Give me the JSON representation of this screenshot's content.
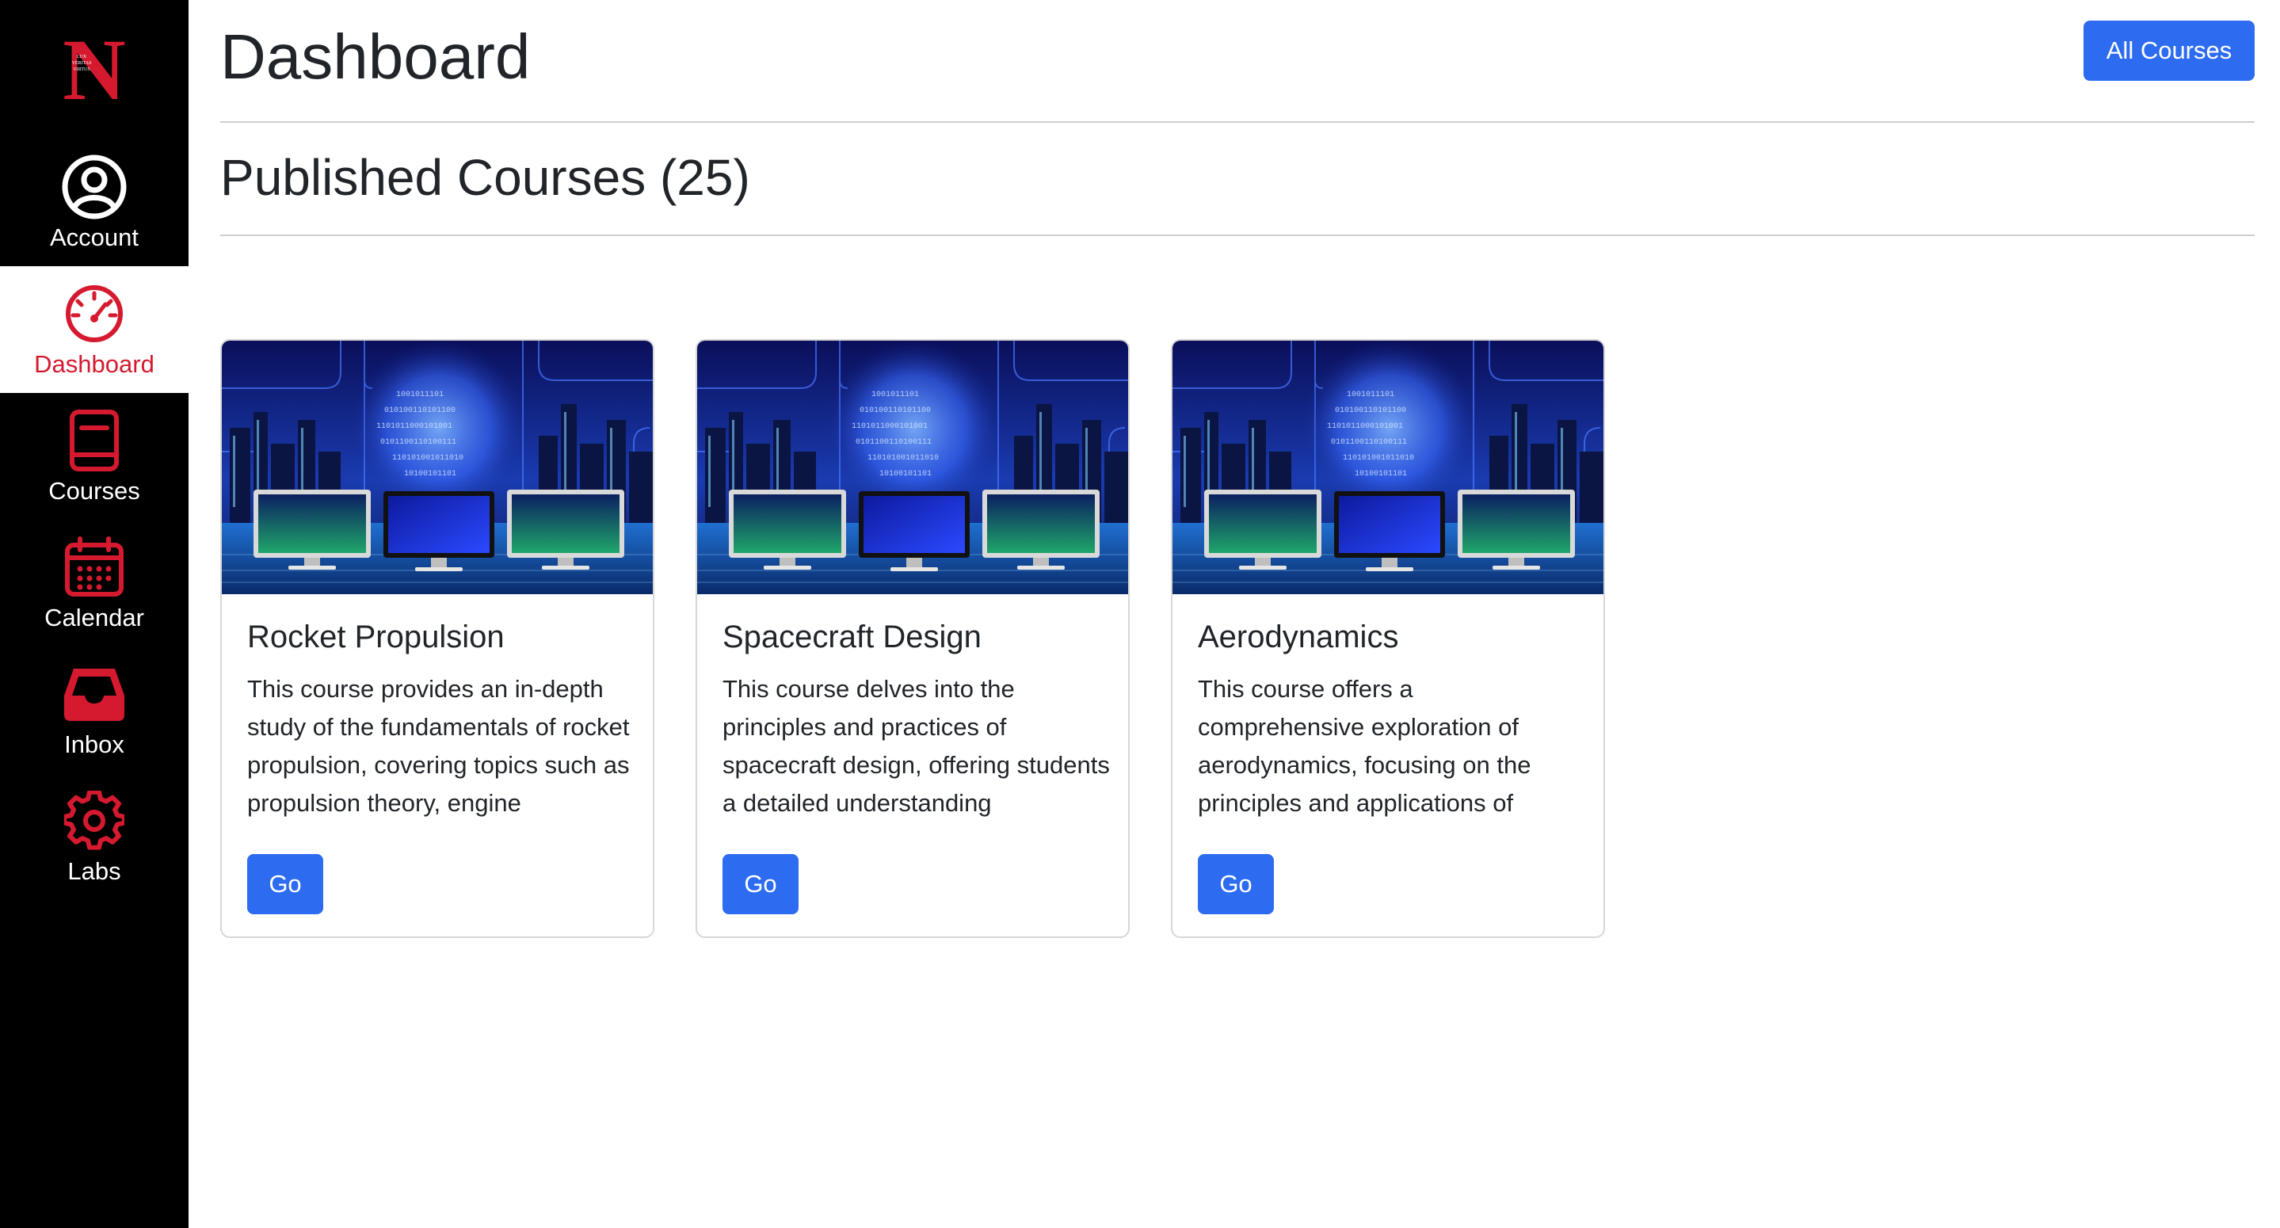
{
  "sidebar": {
    "logo_letter": "N",
    "logo_motto": [
      "LUX",
      "VERITAS",
      "VIRTUS"
    ],
    "items": [
      {
        "label": "Account",
        "icon": "user-circle-icon"
      },
      {
        "label": "Dashboard",
        "icon": "speedometer-icon",
        "active": true
      },
      {
        "label": "Courses",
        "icon": "book-icon"
      },
      {
        "label": "Calendar",
        "icon": "calendar-icon"
      },
      {
        "label": "Inbox",
        "icon": "inbox-tray-icon"
      },
      {
        "label": "Labs",
        "icon": "gear-icon"
      }
    ]
  },
  "header": {
    "title": "Dashboard",
    "all_courses_label": "All Courses"
  },
  "section": {
    "title": "Published Courses (25)"
  },
  "courses": [
    {
      "title": "Rocket Propulsion",
      "description": "This course provides an in-depth study of the fundamentals of rocket propulsion, covering topics such as propulsion theory, engine",
      "button_label": "Go"
    },
    {
      "title": "Spacecraft Design",
      "description": "This course delves into the principles and practices of spacecraft design, offering students a detailed understanding",
      "button_label": "Go"
    },
    {
      "title": "Aerodynamics",
      "description": "This course offers a comprehensive exploration of aerodynamics, focusing on the principles and applications of",
      "button_label": "Go"
    }
  ],
  "colors": {
    "sidebar_bg": "#000000",
    "accent_red": "#d51a2f",
    "primary_blue": "#2d6cf0"
  }
}
